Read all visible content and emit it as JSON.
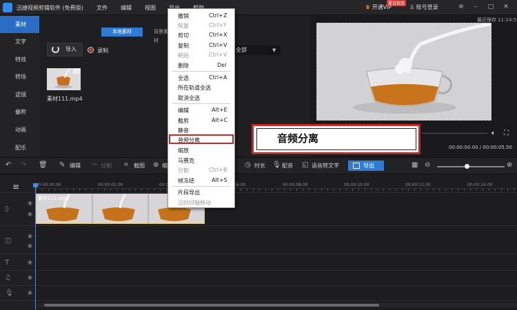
{
  "app": {
    "title": "迅捷视频剪辑软件 (免费版)",
    "menus": [
      "文件",
      "编辑",
      "视图",
      "导出",
      "帮助"
    ],
    "vip_label": "开通VIP",
    "vip_badge": "夏日狂欢",
    "login_label": "账号登录",
    "save_status": "最近保存 11:14:57"
  },
  "sidebar": {
    "items": [
      {
        "label": "素材",
        "active": true
      },
      {
        "label": "文字",
        "active": false
      },
      {
        "label": "特效",
        "active": false
      },
      {
        "label": "转场",
        "active": false
      },
      {
        "label": "滤镜",
        "active": false
      },
      {
        "label": "叠附",
        "active": false
      },
      {
        "label": "动画",
        "active": false
      },
      {
        "label": "配乐",
        "active": false
      }
    ]
  },
  "material": {
    "tab_local": "本地素材",
    "tab_bg": "背景素材",
    "import_label": "导入",
    "record_label": "录制",
    "filter_value": "全部",
    "item_name": "素材111.mp4"
  },
  "preview": {
    "time": "00:00:00.00 / 00:00:05.50"
  },
  "toolbar": {
    "edit": "编辑",
    "split": "分割",
    "crop": "截图",
    "zoom": "缩放",
    "duration": "时长",
    "dub": "配音",
    "speech_to_text": "语音转文字",
    "export": "导出"
  },
  "timeline": {
    "ticks": [
      "00:00:00.00",
      "00:00:02.00",
      "00:00:04.00",
      "00:00:06.00",
      "00:00:08.00",
      "00:00:10.00",
      "00:00:12.00",
      "00:00:14.00"
    ],
    "clip_name": "素材111.mp4"
  },
  "context_menu": {
    "items": [
      {
        "label": "撤销",
        "shortcut": "Ctrl+Z",
        "enabled": true
      },
      {
        "label": "恢复",
        "shortcut": "Ctrl+Y",
        "enabled": false
      },
      {
        "label": "剪切",
        "shortcut": "Ctrl+X",
        "enabled": true
      },
      {
        "label": "复制",
        "shortcut": "Ctrl+V",
        "enabled": true
      },
      {
        "label": "粘贴",
        "shortcut": "Ctrl+V",
        "enabled": false
      },
      {
        "label": "删除",
        "shortcut": "Del",
        "enabled": true
      },
      {
        "label": "全选",
        "shortcut": "Ctrl+A",
        "enabled": true
      },
      {
        "label": "所在轨道全选",
        "shortcut": "",
        "enabled": true
      },
      {
        "label": "取消全选",
        "shortcut": "",
        "enabled": true
      },
      {
        "label": "编辑",
        "shortcut": "Alt+E",
        "enabled": true
      },
      {
        "label": "截剪",
        "shortcut": "Alt+C",
        "enabled": true
      },
      {
        "label": "静音",
        "shortcut": "",
        "enabled": true
      },
      {
        "label": "音频分离",
        "shortcut": "",
        "enabled": true
      },
      {
        "label": "缩放",
        "shortcut": "",
        "enabled": true
      },
      {
        "label": "马赛克",
        "shortcut": "",
        "enabled": true
      },
      {
        "label": "分割",
        "shortcut": "Ctrl+B",
        "enabled": false
      },
      {
        "label": "帧冻结",
        "shortcut": "Alt+S",
        "enabled": true
      },
      {
        "label": "片段导出",
        "shortcut": "",
        "enabled": true
      },
      {
        "label": "沿时间轴移动",
        "shortcut": "",
        "enabled": false
      }
    ]
  },
  "callout": {
    "text": "音频分离"
  }
}
